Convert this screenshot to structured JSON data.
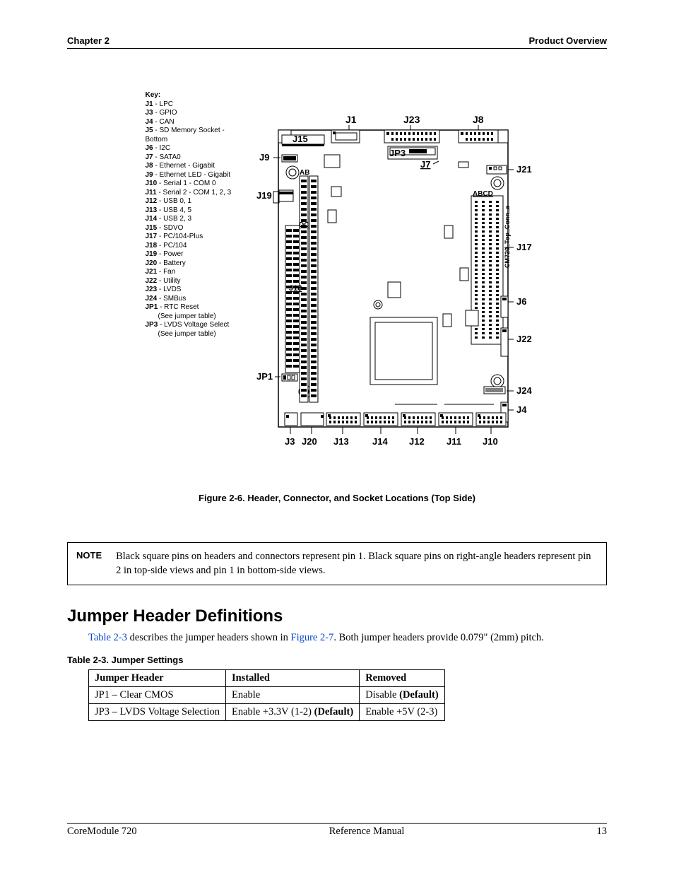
{
  "header": {
    "left": "Chapter 2",
    "right": "Product Overview"
  },
  "key": {
    "title": "Key:",
    "items": [
      {
        "j": "J1",
        "desc": "LPC"
      },
      {
        "j": "J3",
        "desc": "GPIO"
      },
      {
        "j": "J4",
        "desc": "CAN"
      },
      {
        "j": "J5",
        "desc": "SD Memory Socket - Bottom"
      },
      {
        "j": "J6",
        "desc": "I2C"
      },
      {
        "j": "J7",
        "desc": "SATA0"
      },
      {
        "j": "J8",
        "desc": "Ethernet - Gigabit"
      },
      {
        "j": "J9",
        "desc": "Ethernet LED - Gigabit"
      },
      {
        "j": "J10",
        "desc": "Serial 1 - COM 0"
      },
      {
        "j": "J11",
        "desc": "Serial 2 - COM 1, 2, 3"
      },
      {
        "j": "J12",
        "desc": "USB 0, 1"
      },
      {
        "j": "J13",
        "desc": "USB 4, 5"
      },
      {
        "j": "J14",
        "desc": "USB 2, 3"
      },
      {
        "j": "J15",
        "desc": "SDVO"
      },
      {
        "j": "J17",
        "desc": "PC/104-Plus"
      },
      {
        "j": "J18",
        "desc": "PC/104"
      },
      {
        "j": "J19",
        "desc": "Power"
      },
      {
        "j": "J20",
        "desc": "Battery"
      },
      {
        "j": "J21",
        "desc": "Fan"
      },
      {
        "j": "J22",
        "desc": "Utility"
      },
      {
        "j": "J23",
        "desc": "LVDS"
      },
      {
        "j": "J24",
        "desc": "SMBus"
      },
      {
        "j": "JP1",
        "desc": "RTC Reset",
        "note": "(See jumper table)"
      },
      {
        "j": "JP3",
        "desc": "LVDS Voltage Select",
        "note": "(See jumper table)"
      }
    ]
  },
  "board_labels": {
    "top": [
      "J1",
      "J23",
      "J8"
    ],
    "J15": "J15",
    "J9": "J9",
    "AB": "AB",
    "J19": "J19",
    "DC": "DC",
    "J18": "J18",
    "JP1": "JP1",
    "JP3": "JP3",
    "J7": "J7",
    "ABCD": "ABCD",
    "side_text": "CM720_Top_Conn_a",
    "right": [
      "J21",
      "J17",
      "J6",
      "J22",
      "J24",
      "J4"
    ],
    "bottom": [
      "J3",
      "J20",
      "J13",
      "J14",
      "J12",
      "J11",
      "J10"
    ]
  },
  "figure_caption": "Figure  2-6.   Header, Connector, and Socket Locations (Top Side)",
  "note": {
    "label": "NOTE",
    "text": "Black square pins on headers and connectors represent pin 1. Black square pins on right-angle headers represent pin 2 in top-side views and pin 1 in bottom-side views."
  },
  "section_title": "Jumper Header Definitions",
  "body_para": {
    "link1": "Table 2-3",
    "mid": " describes the jumper headers shown in ",
    "link2": "Figure 2-7",
    "tail": ". Both jumper headers provide 0.079\" (2mm) pitch."
  },
  "table": {
    "caption": "Table 2-3.   Jumper Settings",
    "headers": [
      "Jumper Header",
      "Installed",
      "Removed"
    ],
    "rows": [
      {
        "c0": "JP1 – Clear CMOS",
        "c1": "Enable",
        "c2_pre": "Disable ",
        "c2_bold": "(Default)"
      },
      {
        "c0": "JP3 – LVDS Voltage Selection",
        "c1_pre": "Enable +3.3V (1-2) ",
        "c1_bold": "(Default)",
        "c2": "Enable +5V (2-3)"
      }
    ]
  },
  "footer": {
    "left": "CoreModule 720",
    "center": "Reference Manual",
    "right": "13"
  }
}
